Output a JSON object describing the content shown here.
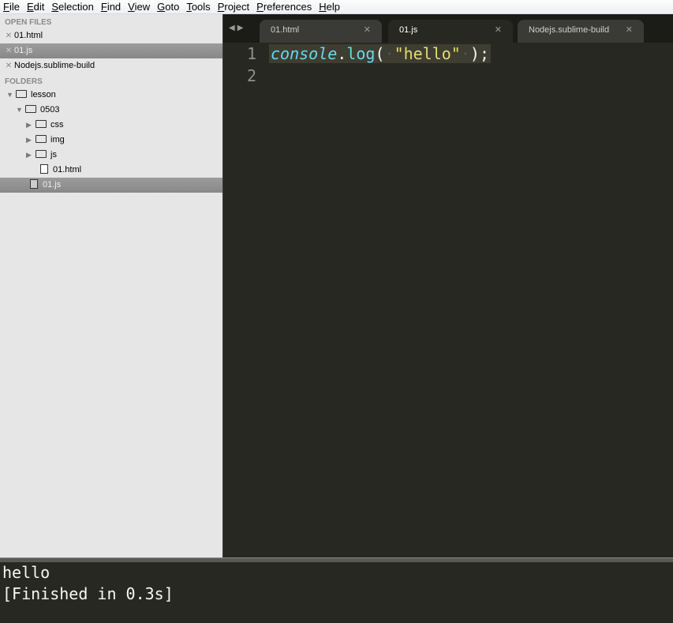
{
  "menu": [
    "File",
    "Edit",
    "Selection",
    "Find",
    "View",
    "Goto",
    "Tools",
    "Project",
    "Preferences",
    "Help"
  ],
  "sidebar": {
    "open_files_label": "OPEN FILES",
    "open_files": [
      "01.html",
      "01.js",
      "Nodejs.sublime-build"
    ],
    "folders_label": "FOLDERS",
    "tree": {
      "root": "lesson",
      "sub": "0503",
      "folders": [
        "css",
        "img",
        "js"
      ],
      "files": [
        "01.html",
        "01.js"
      ]
    }
  },
  "tabs": [
    {
      "label": "01.html"
    },
    {
      "label": "01.js",
      "active": true
    },
    {
      "label": "Nodejs.sublime-build"
    }
  ],
  "editor": {
    "line_numbers": [
      "1",
      "2"
    ],
    "tokens": {
      "obj": "console",
      "dot": ".",
      "fn": "log",
      "open": "(",
      "str": "\"hello\"",
      "close": ");"
    }
  },
  "output": {
    "lines": [
      "hello",
      "[Finished in 0.3s]"
    ]
  },
  "colors": {
    "background": "#272822",
    "keyword": "#66d9ef",
    "string": "#e6db74"
  }
}
